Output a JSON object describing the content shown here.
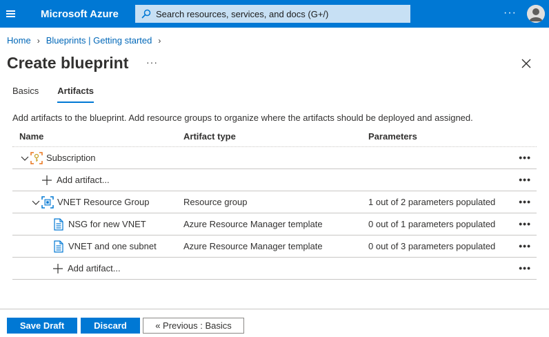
{
  "topbar": {
    "brand": "Microsoft Azure",
    "search_placeholder": "Search resources, services, and docs (G+/)",
    "more": "···"
  },
  "breadcrumb": [
    "Home",
    "Blueprints | Getting started"
  ],
  "page": {
    "title": "Create blueprint",
    "more": "···"
  },
  "tabs": [
    {
      "label": "Basics",
      "active": false
    },
    {
      "label": "Artifacts",
      "active": true
    }
  ],
  "description": "Add artifacts to the blueprint. Add resource groups to organize where the artifacts should be deployed and assigned.",
  "table": {
    "headers": {
      "name": "Name",
      "type": "Artifact type",
      "params": "Parameters"
    },
    "rows": [
      {
        "name": "Subscription",
        "type": "",
        "params": "",
        "icon": "subscription-icon"
      },
      {
        "name": "Add artifact...",
        "type": "",
        "params": "",
        "icon": "add-icon"
      },
      {
        "name": "VNET Resource Group",
        "type": "Resource group",
        "params": "1 out of 2 parameters populated",
        "icon": "resource-group-icon"
      },
      {
        "name": "NSG for new VNET",
        "type": "Azure Resource Manager template",
        "params": "0 out of 1 parameters populated",
        "icon": "template-icon"
      },
      {
        "name": "VNET and one subnet",
        "type": "Azure Resource Manager template",
        "params": "0 out of 3 parameters populated",
        "icon": "template-icon"
      },
      {
        "name": "Add artifact...",
        "type": "",
        "params": "",
        "icon": "add-icon"
      }
    ],
    "row_more": "•••"
  },
  "footer": {
    "save": "Save Draft",
    "discard": "Discard",
    "previous": "« Previous : Basics"
  },
  "colors": {
    "accent": "#0078d4",
    "link": "#0067b8",
    "search_bg": "#c7e0f4"
  }
}
